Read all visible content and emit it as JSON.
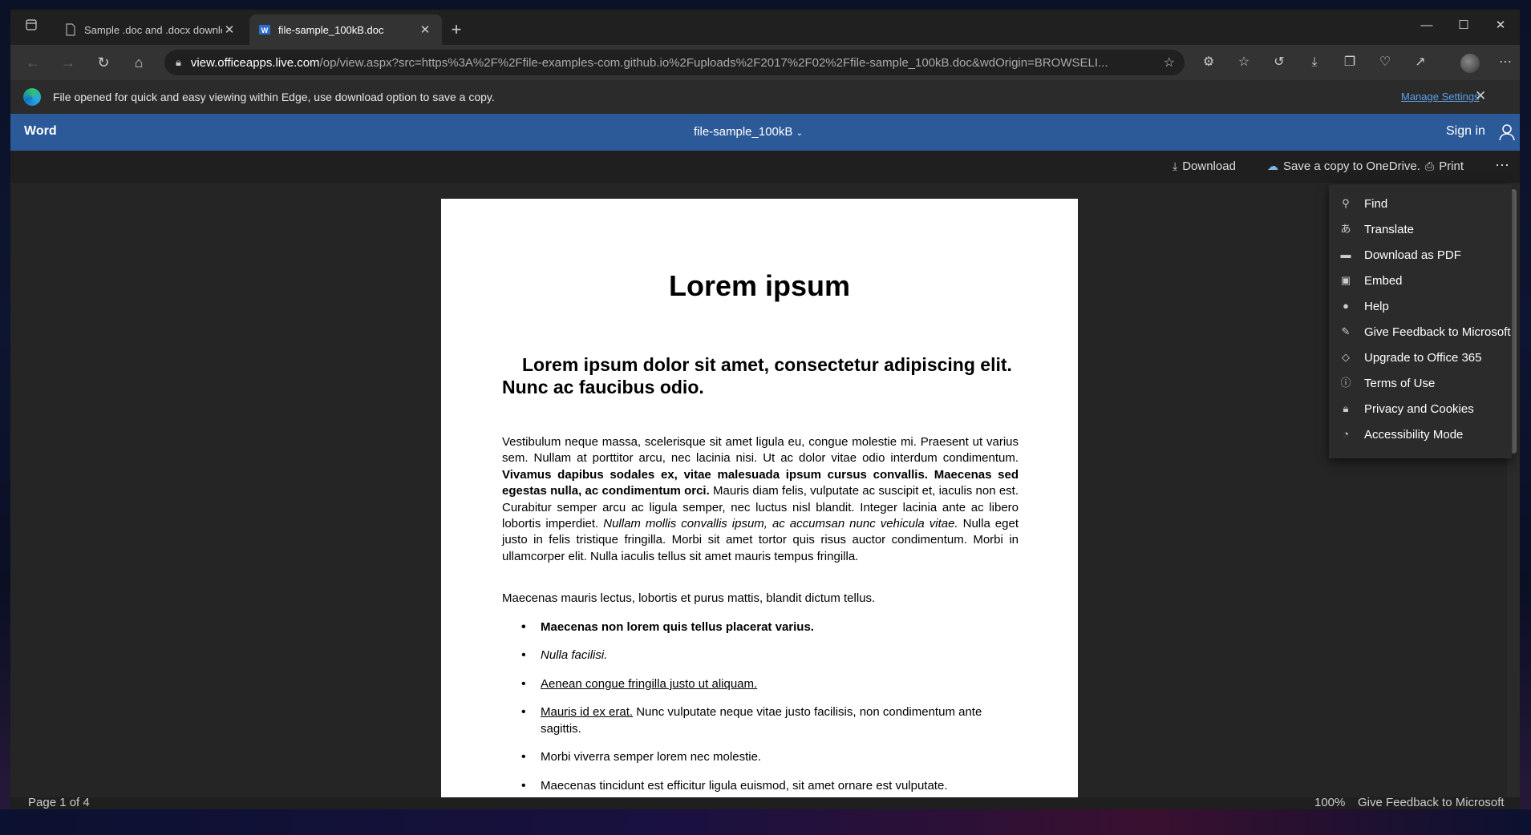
{
  "browser": {
    "tabs": [
      {
        "title": "Sample .doc and .docx downloa",
        "active": false
      },
      {
        "title": "file-sample_100kB.doc",
        "active": true
      }
    ],
    "address": {
      "host": "view.officeapps.live.com",
      "path": "/op/view.aspx?src=https%3A%2F%2Ffile-examples-com.github.io%2Fuploads%2F2017%2F02%2Ffile-sample_100kB.doc&wdOrigin=BROWSELI..."
    },
    "infobar": {
      "message": "File opened for quick and easy viewing within Edge, use download option to save a copy.",
      "manage_settings": "Manage Settings"
    }
  },
  "word": {
    "app_name": "Word",
    "doc_title": "file-sample_100kB",
    "sign_in": "Sign in",
    "commands": {
      "download": "Download",
      "save_copy": "Save a copy to OneDrive.",
      "print": "Print"
    },
    "menu": [
      {
        "label": "Find",
        "icon": "search-icon"
      },
      {
        "label": "Translate",
        "icon": "translate-icon"
      },
      {
        "label": "Download as PDF",
        "icon": "pdf-icon"
      },
      {
        "label": "Embed",
        "icon": "embed-icon"
      },
      {
        "label": "Help",
        "icon": "help-icon"
      },
      {
        "label": "Give Feedback to Microsoft",
        "icon": "feedback-icon"
      },
      {
        "label": "Upgrade to Office 365",
        "icon": "diamond-icon"
      },
      {
        "label": "Terms of Use",
        "icon": "info-icon"
      },
      {
        "label": "Privacy and Cookies",
        "icon": "lock-icon"
      },
      {
        "label": "Accessibility Mode",
        "icon": "accessibility-icon"
      }
    ],
    "status": {
      "page": "Page 1 of 4",
      "zoom": "100%",
      "feedback": "Give Feedback to Microsoft"
    }
  },
  "document": {
    "title": "Lorem ipsum",
    "heading": "Lorem ipsum dolor sit amet, consectetur adipiscing elit. Nunc ac faucibus odio.",
    "p1": {
      "a": "Vestibulum neque massa, scelerisque sit amet ligula eu, congue molestie mi. Praesent ut varius sem. Nullam at porttitor arcu, nec lacinia nisi. Ut ac dolor vitae odio interdum condimentum. ",
      "b": "Vivamus dapibus sodales ex, vitae malesuada ipsum cursus convallis. Maecenas sed egestas nulla, ac condimentum orci.",
      "c": " Mauris diam felis, vulputate ac suscipit et, iaculis non est. Curabitur semper arcu ac ligula semper, nec luctus nisl blandit. Integer lacinia ante ac libero lobortis imperdiet. ",
      "d": "Nullam mollis convallis ipsum, ac accumsan nunc vehicula vitae.",
      "e": " Nulla eget justo in felis tristique fringilla. Morbi sit amet tortor quis risus auctor condimentum. Morbi in ullamcorper elit. Nulla iaculis tellus sit amet mauris tempus fringilla."
    },
    "p2": "Maecenas mauris lectus, lobortis et purus mattis, blandit dictum tellus.",
    "bullets": {
      "b1": "Maecenas non lorem quis tellus placerat varius.",
      "b2": "Nulla facilisi.",
      "b3": "Aenean congue fringilla justo ut aliquam.",
      "b4_u": "Mauris id ex erat.",
      "b4_rest": " Nunc vulputate neque vitae justo facilisis, non condimentum ante sagittis.",
      "b5": "Morbi viverra semper lorem nec molestie.",
      "b6": "Maecenas tincidunt est efficitur ligula euismod, sit amet ornare est vulputate."
    }
  }
}
